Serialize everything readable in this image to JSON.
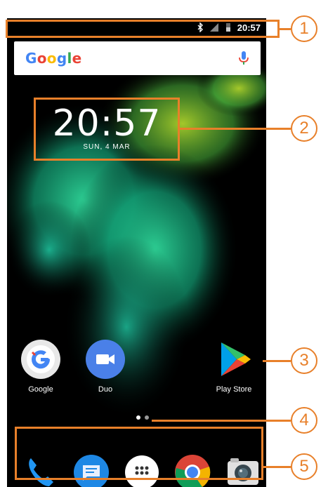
{
  "status_bar": {
    "time": "20:57",
    "icons": [
      "bluetooth-icon",
      "signal-icon",
      "battery-icon"
    ]
  },
  "search_bar": {
    "logo": "Google",
    "mic_icon": "microphone-icon"
  },
  "clock_widget": {
    "time": "20:57",
    "date": "SUN, 4 MAR"
  },
  "apps": [
    {
      "label": "Google",
      "icon": "google-app-icon"
    },
    {
      "label": "Duo",
      "icon": "duo-icon"
    },
    {
      "label": "Play Store",
      "icon": "play-store-icon"
    }
  ],
  "page_indicator": {
    "pages": 2,
    "current": 1
  },
  "dock": [
    {
      "icon": "phone-icon"
    },
    {
      "icon": "messages-icon"
    },
    {
      "icon": "app-drawer-icon"
    },
    {
      "icon": "chrome-icon"
    },
    {
      "icon": "camera-icon"
    }
  ],
  "callouts": [
    "1",
    "2",
    "3",
    "4",
    "5"
  ],
  "colors": {
    "callout": "#E8802A",
    "wallpaper_base": "#000000",
    "smoke_green": "#3CC48A"
  }
}
